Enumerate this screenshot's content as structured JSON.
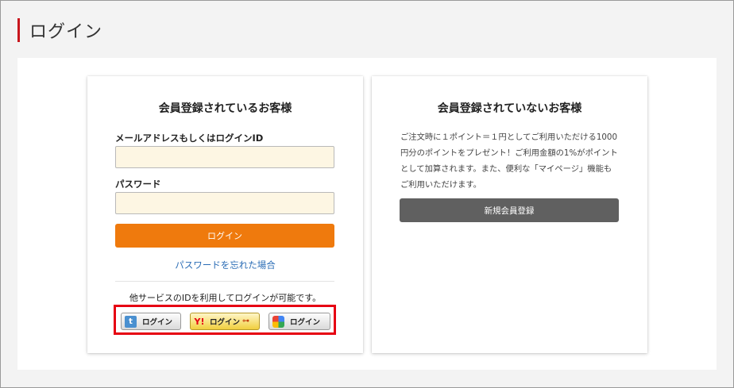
{
  "page": {
    "title": "ログイン"
  },
  "member_card": {
    "title": "会員登録されているお客様",
    "email_label": "メールアドレスもしくはログインID",
    "email_value": "",
    "password_label": "パスワード",
    "password_value": "",
    "login_button": "ログイン",
    "forgot_link": "パスワードを忘れた場合",
    "social_caption": "他サービスのIDを利用してログインが可能です。",
    "social": {
      "twitter": {
        "label": "ログイン",
        "icon": "twitter-icon",
        "color": "#4a90d0"
      },
      "yahoo": {
        "label": "ログイン",
        "icon": "yahoo-icon",
        "color": "#e60012"
      },
      "google": {
        "label": "ログイン",
        "icon": "google-icon"
      }
    }
  },
  "guest_card": {
    "title": "会員登録されていないお客様",
    "description_lines": [
      "ご注文時に１ポイント＝１円としてご利用いただける1000",
      "円分のポイントをプレゼント！ご利用金額の1%がポイント",
      "として加算されます。また、便利な「マイページ」機能も",
      "ご利用いただけます。"
    ],
    "register_button": "新規会員登録"
  },
  "colors": {
    "accent_red": "#c8161d",
    "login_orange": "#ef7a0d",
    "register_gray": "#606060",
    "link_blue": "#2a6cb5",
    "highlight_red": "#e60012",
    "input_bg": "#fdf6e3"
  }
}
